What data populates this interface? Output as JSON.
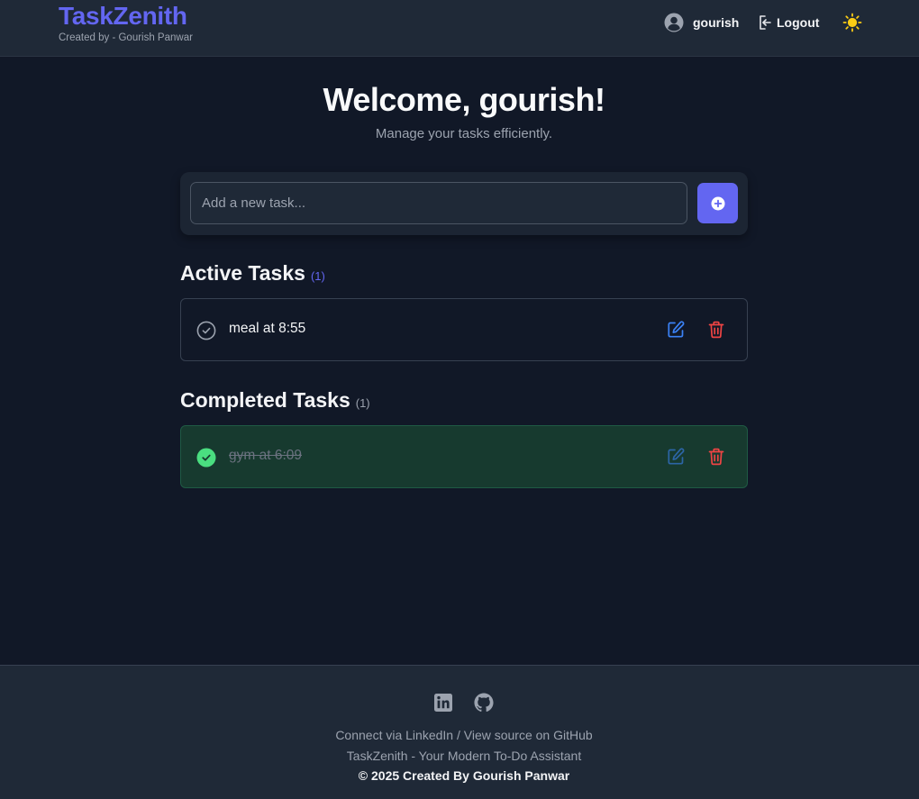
{
  "header": {
    "brand": "TaskZenith",
    "subtitle": "Created by - Gourish Panwar",
    "username": "gourish",
    "logout_label": "Logout",
    "icons": {
      "user": "user-circle-icon",
      "logout": "logout-icon",
      "theme": "sun-icon"
    }
  },
  "hero": {
    "welcome": "Welcome, gourish!",
    "tagline": "Manage your tasks efficiently."
  },
  "add_task": {
    "placeholder": "Add a new task...",
    "value": "",
    "button_icon": "plus-circle-icon"
  },
  "active": {
    "heading": "Active Tasks",
    "count": "(1)",
    "tasks": [
      {
        "text": "meal at 8:55",
        "completed": false
      }
    ]
  },
  "completed": {
    "heading": "Completed Tasks",
    "count": "(1)",
    "tasks": [
      {
        "text": "gym at 6:09",
        "completed": true
      }
    ]
  },
  "footer": {
    "social_icons": [
      "linkedin-icon",
      "github-icon"
    ],
    "connect_prefix": "Connect via ",
    "linkedin_label": "LinkedIn",
    "separator": " / ",
    "github_label": "View source on GitHub",
    "tagline": "TaskZenith - Your Modern To-Do Assistant",
    "copyright": "© 2025 Created By Gourish Panwar"
  },
  "colors": {
    "background": "#111827",
    "header_bg": "#1f2937",
    "accent": "#6366f1",
    "edit": "#3b82f6",
    "delete": "#ef4444",
    "done_bg": "#173a2f",
    "done_check": "#4ade80",
    "theme_icon": "#facc15"
  }
}
